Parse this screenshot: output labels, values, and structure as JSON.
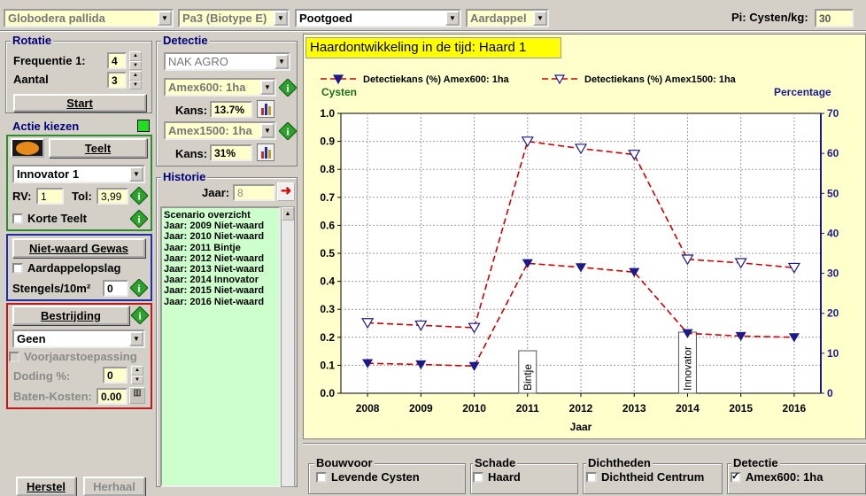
{
  "top": {
    "organism": "Globodera pallida",
    "pathotype": "Pa3  (Biotype E)",
    "crop_type": "Pootgoed",
    "crop": "Aardappel",
    "pi_label": "Pi: Cysten/kg:",
    "pi_value": "30"
  },
  "rotatie": {
    "title": "Rotatie",
    "freq_label": "Frequentie 1:",
    "freq_value": "4",
    "aantal_label": "Aantal",
    "aantal_value": "3",
    "start": "Start"
  },
  "actie": {
    "title": "Actie kiezen",
    "teelt_btn": "Teelt",
    "variety": "Innovator 1",
    "rv_label": "RV:",
    "rv_value": "1",
    "tol_label": "Tol:",
    "tol_value": "3,99",
    "korte_teelt": "Korte Teelt",
    "niet_waard": "Niet-waard Gewas",
    "aardappelopslag": "Aardappelopslag",
    "stengels_label": "Stengels/10m²",
    "stengels_value": "0",
    "bestrijding_btn": "Bestrijding",
    "bestrijding_value": "Geen",
    "voorjaar": "Voorjaarstoepassing",
    "doding_label": "Doding %:",
    "doding_value": "0",
    "baten_label": "Baten-Kosten:",
    "baten_value": "0.00",
    "herstel": "Herstel",
    "herhaal": "Herhaal"
  },
  "detectie": {
    "title": "Detectie",
    "lab": "NAK AGRO",
    "method1": "Amex600: 1ha",
    "kans1_label": "Kans:",
    "kans1": "13.7%",
    "method2": "Amex1500: 1ha",
    "kans2_label": "Kans:",
    "kans2": "31%"
  },
  "historie": {
    "title": "Historie",
    "jaar_label": "Jaar:",
    "jaar_value": "8",
    "items": [
      "Scenario overzicht",
      "Jaar: 2009 Niet-waard",
      "Jaar: 2010 Niet-waard",
      "Jaar: 2011 Bintje",
      "Jaar: 2012 Niet-waard",
      "Jaar: 2013 Niet-waard",
      "Jaar: 2014 Innovator",
      "Jaar: 2015 Niet-waard",
      "Jaar: 2016 Niet-waard"
    ]
  },
  "chart_data": {
    "type": "line",
    "title": "Haardontwikkeling in de tijd: Haard 1",
    "xlabel": "Jaar",
    "ylabel_left": "Cysten",
    "ylabel_right": "Percentage",
    "x": [
      2008,
      2009,
      2010,
      2011,
      2012,
      2013,
      2014,
      2015,
      2016
    ],
    "ylim_left": [
      0,
      1.0
    ],
    "ylim_right": [
      0,
      70
    ],
    "yticks_left": [
      "0.0",
      "0.1",
      "0.2",
      "0.3",
      "0.4",
      "0.5",
      "0.6",
      "0.7",
      "0.8",
      "0.9",
      "1.0"
    ],
    "yticks_right": [
      "0",
      "10",
      "20",
      "30",
      "40",
      "50",
      "60",
      "70"
    ],
    "grid": true,
    "legend_position": "top",
    "series": [
      {
        "name": "Detectiekans (%) Amex600: 1ha",
        "axis": "right",
        "marker": "filled-triangle-down",
        "values": [
          7.5,
          7.2,
          6.8,
          32.5,
          31.5,
          30.3,
          15.0,
          14.3,
          14.0
        ]
      },
      {
        "name": "Detectiekans (%) Amex1500: 1ha",
        "axis": "right",
        "marker": "open-triangle-down",
        "values": [
          17.6,
          17.0,
          16.4,
          63.0,
          61.2,
          59.7,
          33.5,
          32.6,
          31.4
        ]
      }
    ],
    "annotations": [
      {
        "x": 2011,
        "text": "Bintje"
      },
      {
        "x": 2014,
        "text": "Innovator"
      }
    ],
    "colors": {
      "line": "#cc0000",
      "marker": "#1a1a8c",
      "right_axis": "#1a1a8c",
      "left_axis": "#000000",
      "plot_bg": "#ffffff",
      "title_bg": "#ffff00",
      "chart_bg": "#ffffcc"
    }
  },
  "bottom": {
    "groups": [
      {
        "title": "Bouwvoor",
        "item": "Levende Cysten",
        "checked": false
      },
      {
        "title": "Schade",
        "item": "Haard",
        "checked": false
      },
      {
        "title": "Dichtheden",
        "item": "Dichtheid Centrum",
        "checked": false
      },
      {
        "title": "Detectie",
        "item": "Amex600: 1ha",
        "checked": true
      }
    ]
  }
}
